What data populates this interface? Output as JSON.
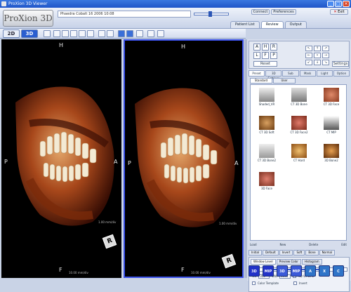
{
  "window": {
    "title": "ProXion 3D Viewer"
  },
  "header": {
    "logo_text": "ProXion 3D",
    "patient_info": "Phaedra Cobalt  16 2006 10:08",
    "connect_label": "Connect",
    "preferences_label": "Preferences",
    "exit_label": "Exit"
  },
  "tabs": [
    {
      "label": "Patient List",
      "active": false
    },
    {
      "label": "Review",
      "active": true
    },
    {
      "label": "Output",
      "active": false
    }
  ],
  "toolbar": {
    "mode_2d": "2D",
    "mode_3d": "3D",
    "active_mode": "3D"
  },
  "viewports": [
    {
      "top": "H",
      "left": "P",
      "right": "A",
      "bottom": "F",
      "side_label": "1.00 mm/div",
      "bottom_label": "10.00 mm/div",
      "cube_label": "R"
    },
    {
      "top": "H",
      "left": "P",
      "right": "A",
      "bottom": "F",
      "side_label": "1.00 mm/div",
      "bottom_label": "10.00 mm/div",
      "cube_label": "R"
    }
  ],
  "navpad": {
    "keys": [
      "A",
      "H",
      "R",
      "L",
      "F",
      "P"
    ],
    "reset_label": "Reset",
    "settings_label": "Settings"
  },
  "panel_tabs": [
    "Preset",
    "3D Settings",
    "Sub",
    "Mask",
    "Light",
    "Option"
  ],
  "panel_active_tab": "Preset",
  "sub_tabs": [
    "Standard",
    "User"
  ],
  "thumbnails": [
    {
      "label": "Shaded_VR"
    },
    {
      "label": "CT 3D Bone"
    },
    {
      "label": "CT 3D Face"
    },
    {
      "label": "CT 3D Soft"
    },
    {
      "label": "CT 3D Face2"
    },
    {
      "label": "CT MIP"
    },
    {
      "label": "CT 3D Bone2"
    },
    {
      "label": "CT Hard"
    },
    {
      "label": "3D Bone2"
    },
    {
      "label": "3D Face"
    }
  ],
  "preset_bar": {
    "load": "Load",
    "new": "New",
    "delete": "Delete",
    "edit": "Edit"
  },
  "wl_tabs": [
    "Initial",
    "Default",
    "Invert",
    "Soft",
    "Bone",
    "Normal"
  ],
  "wl_subtabs": [
    "Window Level",
    "Preview Color",
    "Histogram"
  ],
  "wl_active_subtab": "Window Level",
  "wl": {
    "wl_label": "WL",
    "wl_value": "300",
    "ww_label": "WW",
    "ww_value": "1500",
    "link_label": "3D VR Link",
    "color_template_label": "Color Template",
    "invert_label": "Invert"
  },
  "render_buttons": [
    {
      "label": "3D",
      "color": "#2233c8"
    },
    {
      "label": "MIP",
      "color": "#2233c8"
    },
    {
      "label": "3D",
      "color": "#3b5ad8"
    },
    {
      "label": "MIP",
      "color": "#3b5ad8"
    },
    {
      "label": "A",
      "color": "#2f74c8"
    },
    {
      "label": "X",
      "color": "#2f74c8"
    },
    {
      "label": "C",
      "color": "#2f74c8"
    }
  ],
  "colors": {
    "accent": "#2a55b5",
    "viewport_bg": "#000000",
    "selected_border": "#3a50e8"
  }
}
